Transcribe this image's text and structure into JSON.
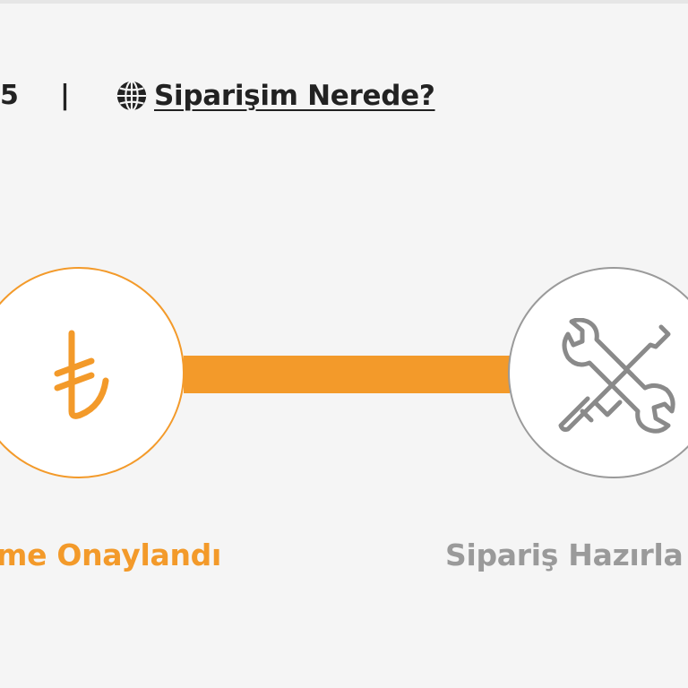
{
  "header": {
    "phone_tail": "5",
    "divider": "|",
    "track_link_label": "Siparişim Nerede?",
    "track_link_icon": "globe-icon"
  },
  "steps": [
    {
      "label": "me Onaylandı",
      "icon": "turkish-lira-icon",
      "symbol": "₺",
      "status": "completed",
      "color": "#f39a2a"
    },
    {
      "label": "Sipariş Hazırla",
      "icon": "tools-icon",
      "status": "pending",
      "color": "#9a9a9a"
    }
  ],
  "colors": {
    "accent": "#f39a2a",
    "inactive": "#9a9a9a",
    "text": "#222222",
    "background": "#f5f5f5"
  }
}
